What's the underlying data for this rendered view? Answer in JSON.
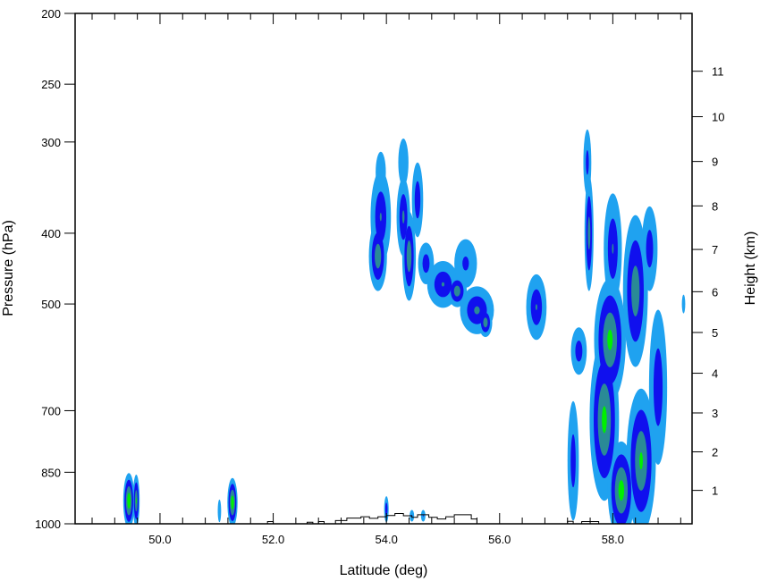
{
  "chart_data": {
    "type": "contour",
    "xlabel": "Latitude (deg)",
    "ylabel": "Pressure (hPa)",
    "y2label": "Height (km)",
    "xlim": [
      48.5,
      59.4
    ],
    "ylim": [
      1000,
      200
    ],
    "xticks": [
      "50.0",
      "52.0",
      "54.0",
      "56.0",
      "58.0"
    ],
    "xtick_values": [
      50.0,
      52.0,
      54.0,
      56.0,
      58.0
    ],
    "yticks": [
      "200",
      "250",
      "300",
      "400",
      "500",
      "700",
      "850",
      "1000"
    ],
    "ytick_values": [
      200,
      250,
      300,
      400,
      500,
      700,
      850,
      1000
    ],
    "y2ticks": [
      "1",
      "2",
      "3",
      "4",
      "5",
      "6",
      "7",
      "8",
      "9",
      "10",
      "11"
    ],
    "y2tick_values": [
      1,
      2,
      3,
      4,
      5,
      6,
      7,
      8,
      9,
      10,
      11
    ],
    "y2_pressure_at": [
      900,
      797,
      705,
      622,
      547,
      481,
      421,
      367,
      319,
      277,
      240
    ],
    "contour_levels": 4,
    "level_colors": [
      "#1fa2f0",
      "#1010ee",
      "#2a8a96",
      "#00f000"
    ],
    "grid": false,
    "cells": [
      {
        "lat": 53.9,
        "p": 330,
        "w": 0.09,
        "dp": 22,
        "v": 1.0
      },
      {
        "lat": 53.9,
        "p": 380,
        "w": 0.18,
        "dp": 60,
        "v": 2.2
      },
      {
        "lat": 53.85,
        "p": 430,
        "w": 0.16,
        "dp": 50,
        "v": 3.1
      },
      {
        "lat": 54.3,
        "p": 320,
        "w": 0.09,
        "dp": 25,
        "v": 1.0
      },
      {
        "lat": 54.3,
        "p": 380,
        "w": 0.12,
        "dp": 50,
        "v": 2.4
      },
      {
        "lat": 54.4,
        "p": 430,
        "w": 0.12,
        "dp": 65,
        "v": 3.1
      },
      {
        "lat": 54.55,
        "p": 360,
        "w": 0.1,
        "dp": 45,
        "v": 2.0
      },
      {
        "lat": 54.7,
        "p": 440,
        "w": 0.14,
        "dp": 30,
        "v": 1.8
      },
      {
        "lat": 55.0,
        "p": 470,
        "w": 0.28,
        "dp": 36,
        "v": 2.2
      },
      {
        "lat": 55.25,
        "p": 480,
        "w": 0.17,
        "dp": 25,
        "v": 3.0
      },
      {
        "lat": 55.6,
        "p": 510,
        "w": 0.3,
        "dp": 40,
        "v": 2.4
      },
      {
        "lat": 55.75,
        "p": 530,
        "w": 0.12,
        "dp": 25,
        "v": 3.0
      },
      {
        "lat": 55.4,
        "p": 440,
        "w": 0.2,
        "dp": 35,
        "v": 1.4
      },
      {
        "lat": 56.65,
        "p": 505,
        "w": 0.18,
        "dp": 55,
        "v": 2.2
      },
      {
        "lat": 57.4,
        "p": 580,
        "w": 0.14,
        "dp": 45,
        "v": 1.8
      },
      {
        "lat": 57.55,
        "p": 320,
        "w": 0.07,
        "dp": 35,
        "v": 1.6
      },
      {
        "lat": 57.58,
        "p": 400,
        "w": 0.08,
        "dp": 80,
        "v": 2.8
      },
      {
        "lat": 57.3,
        "p": 820,
        "w": 0.1,
        "dp": 170,
        "v": 1.8
      },
      {
        "lat": 57.85,
        "p": 720,
        "w": 0.26,
        "dp": 210,
        "v": 3.6
      },
      {
        "lat": 57.95,
        "p": 560,
        "w": 0.28,
        "dp": 120,
        "v": 3.6
      },
      {
        "lat": 58.0,
        "p": 420,
        "w": 0.16,
        "dp": 80,
        "v": 2.2
      },
      {
        "lat": 58.15,
        "p": 900,
        "w": 0.24,
        "dp": 150,
        "v": 3.8
      },
      {
        "lat": 58.4,
        "p": 480,
        "w": 0.22,
        "dp": 130,
        "v": 3.0
      },
      {
        "lat": 58.5,
        "p": 820,
        "w": 0.26,
        "dp": 210,
        "v": 3.4
      },
      {
        "lat": 58.65,
        "p": 420,
        "w": 0.14,
        "dp": 60,
        "v": 1.8
      },
      {
        "lat": 58.8,
        "p": 650,
        "w": 0.16,
        "dp": 180,
        "v": 2.0
      },
      {
        "lat": 59.25,
        "p": 500,
        "w": 0.03,
        "dp": 15,
        "v": 1.0
      },
      {
        "lat": 49.45,
        "p": 930,
        "w": 0.1,
        "dp": 85,
        "v": 4.2
      },
      {
        "lat": 49.58,
        "p": 930,
        "w": 0.06,
        "dp": 80,
        "v": 3.4
      },
      {
        "lat": 51.28,
        "p": 935,
        "w": 0.09,
        "dp": 75,
        "v": 4.2
      },
      {
        "lat": 51.05,
        "p": 960,
        "w": 0.03,
        "dp": 35,
        "v": 1.0
      },
      {
        "lat": 54.0,
        "p": 955,
        "w": 0.04,
        "dp": 40,
        "v": 2.0
      },
      {
        "lat": 54.45,
        "p": 975,
        "w": 0.04,
        "dp": 18,
        "v": 1.2
      },
      {
        "lat": 54.65,
        "p": 975,
        "w": 0.04,
        "dp": 18,
        "v": 1.2
      }
    ],
    "terrain_profile": [
      [
        51.9,
        1000
      ],
      [
        51.9,
        993
      ],
      [
        52.0,
        993
      ],
      [
        52.0,
        1000
      ],
      [
        52.6,
        1000
      ],
      [
        52.6,
        995
      ],
      [
        52.7,
        995
      ],
      [
        52.7,
        1000
      ],
      [
        52.8,
        1000
      ],
      [
        52.8,
        993
      ],
      [
        52.9,
        993
      ],
      [
        52.9,
        1000
      ],
      [
        53.1,
        1000
      ],
      [
        53.1,
        990
      ],
      [
        53.3,
        990
      ],
      [
        53.3,
        982
      ],
      [
        53.55,
        982
      ],
      [
        53.55,
        978
      ],
      [
        53.7,
        978
      ],
      [
        53.7,
        983
      ],
      [
        53.85,
        983
      ],
      [
        53.85,
        978
      ],
      [
        54.0,
        978
      ],
      [
        54.0,
        974
      ],
      [
        54.15,
        974
      ],
      [
        54.15,
        968
      ],
      [
        54.3,
        968
      ],
      [
        54.3,
        975
      ],
      [
        54.45,
        975
      ],
      [
        54.45,
        980
      ],
      [
        54.55,
        980
      ],
      [
        54.55,
        972
      ],
      [
        54.75,
        972
      ],
      [
        54.75,
        980
      ],
      [
        54.9,
        980
      ],
      [
        54.9,
        985
      ],
      [
        55.05,
        985
      ],
      [
        55.05,
        978
      ],
      [
        55.2,
        978
      ],
      [
        55.2,
        972
      ],
      [
        55.5,
        972
      ],
      [
        55.5,
        985
      ],
      [
        55.6,
        985
      ],
      [
        55.6,
        1000
      ],
      [
        57.2,
        1000
      ],
      [
        57.2,
        992
      ],
      [
        57.3,
        992
      ],
      [
        57.3,
        1000
      ],
      [
        57.45,
        1000
      ],
      [
        57.45,
        993
      ],
      [
        57.75,
        993
      ],
      [
        57.75,
        1000
      ]
    ]
  }
}
